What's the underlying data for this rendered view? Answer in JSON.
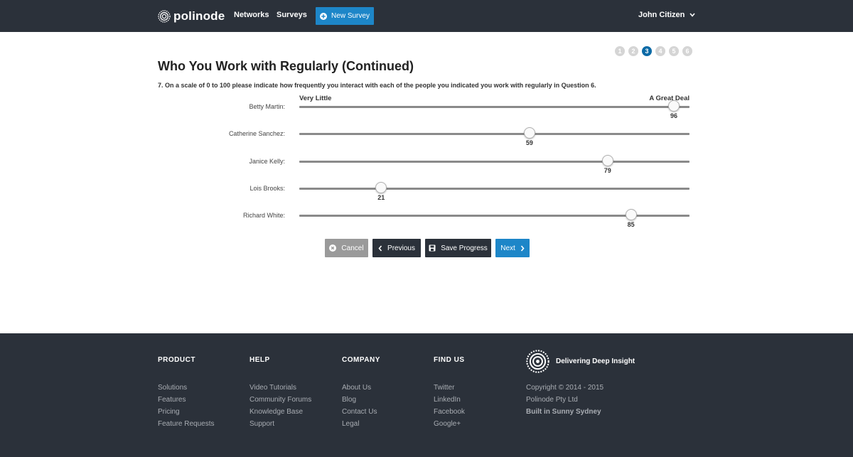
{
  "navbar": {
    "brand": "polinode",
    "links": [
      "Networks",
      "Surveys"
    ],
    "new_survey_label": "New Survey",
    "user_name": "John Citizen"
  },
  "progress_steps": {
    "steps": [
      "1",
      "2",
      "3",
      "4",
      "5",
      "6"
    ],
    "current": "3",
    "active_color": "#0b6aa6"
  },
  "survey": {
    "title": "Who You Work with Regularly (Continued)",
    "question": "7. On a scale of 0 to 100 please indicate how frequently you interact with each of the people you indicated you work with regularly in Question 6.",
    "scale_min_label": "Very Little",
    "scale_max_label": "A Great Deal",
    "scale_range": [
      0,
      100
    ],
    "sliders": [
      {
        "label": "Betty Martin:",
        "value": 96
      },
      {
        "label": "Catherine Sanchez:",
        "value": 59
      },
      {
        "label": "Janice Kelly:",
        "value": 79
      },
      {
        "label": "Lois Brooks:",
        "value": 21
      },
      {
        "label": "Richard White:",
        "value": 85
      }
    ]
  },
  "actions": {
    "cancel_label": "Cancel",
    "previous_label": "Previous",
    "save_label": "Save Progress",
    "next_label": "Next",
    "primary_color": "#1d86c8",
    "dark_color": "#2b313a"
  },
  "footer": {
    "columns": [
      {
        "heading": "PRODUCT",
        "links": [
          "Solutions",
          "Features",
          "Pricing",
          "Feature Requests"
        ]
      },
      {
        "heading": "HELP",
        "links": [
          "Video Tutorials",
          "Community Forums",
          "Knowledge Base",
          "Support"
        ]
      },
      {
        "heading": "COMPANY",
        "links": [
          "About Us",
          "Blog",
          "Contact Us",
          "Legal"
        ]
      },
      {
        "heading": "FIND US",
        "links": [
          "Twitter",
          "LinkedIn",
          "Facebook",
          "Google+"
        ]
      }
    ],
    "tagline": "Delivering Deep Insight",
    "copyright": "Copyright © 2014 - 2015",
    "company": "Polinode Pty Ltd",
    "built_in": "Built in Sunny Sydney"
  }
}
